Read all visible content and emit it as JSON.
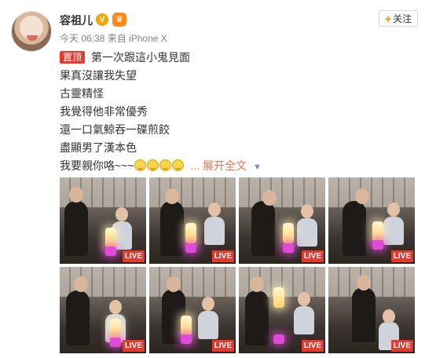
{
  "user": {
    "name": "容祖儿",
    "verified_mark": "V",
    "crown_icon": "crown-icon"
  },
  "follow_button": {
    "label": "关注"
  },
  "meta": {
    "time": "今天 06:38",
    "source": "来自 iPhone X"
  },
  "post": {
    "pin_label": "置顶",
    "lines": [
      "第一次跟這小鬼見面",
      "果真沒讓我失望",
      "古靈精怪",
      "我覺得他非常優秀",
      "還一口氣鯨吞一碟煎餃",
      "盡顯男了漢本色",
      "我要親你咯~~~"
    ],
    "more_label": "展开全文"
  },
  "photos": {
    "badge_label": "LIVE",
    "count": 8
  }
}
